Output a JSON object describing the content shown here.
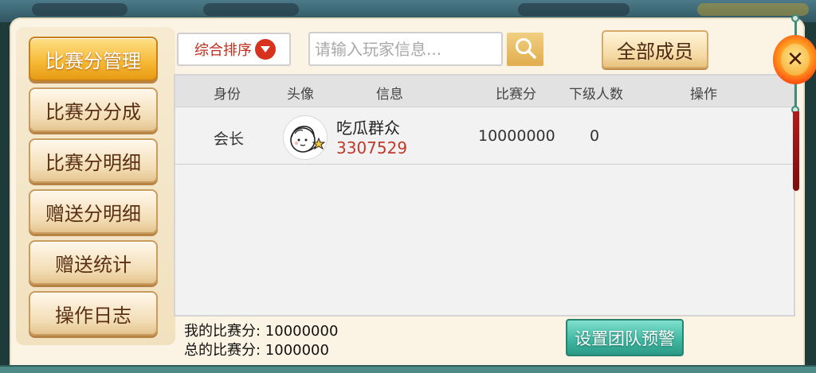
{
  "sidebar": {
    "items": [
      {
        "label": "比赛分管理",
        "active": true
      },
      {
        "label": "比赛分分成",
        "active": false
      },
      {
        "label": "比赛分明细",
        "active": false
      },
      {
        "label": "赠送分明细",
        "active": false
      },
      {
        "label": "赠送统计",
        "active": false
      },
      {
        "label": "操作日志",
        "active": false
      }
    ]
  },
  "toolbar": {
    "sort_label": "综合排序",
    "search_placeholder": "请输入玩家信息...",
    "search_value": "",
    "all_members_label": "全部成员"
  },
  "table": {
    "headers": {
      "role": "身份",
      "avatar": "头像",
      "info": "信息",
      "score": "比赛分",
      "sub_count": "下级人数",
      "action": "操作"
    },
    "rows": [
      {
        "role": "会长",
        "name": "吃瓜群众",
        "id": "3307529",
        "score": "10000000",
        "sub_count": "0"
      }
    ]
  },
  "footer": {
    "my_score_label": "我的比赛分: 10000000",
    "total_score_label": "总的比赛分: 1000000",
    "warn_button": "设置团队预警"
  },
  "colors": {
    "accent_orange": "#f6b833",
    "id_red": "#c0392b",
    "teal_button": "#3eb5a0",
    "parchment": "#fbf4e4"
  },
  "icons": {
    "sort": "caret-down-icon",
    "search": "magnifier-icon",
    "close": "close-icon"
  }
}
